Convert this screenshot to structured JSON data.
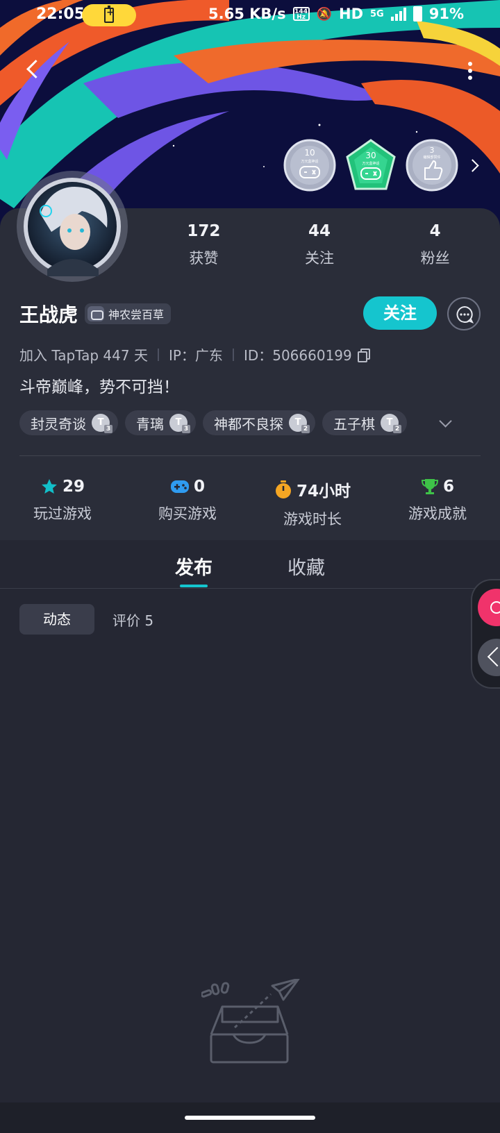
{
  "status_bar": {
    "time": "22:05",
    "net_speed": "5.65 KB/s",
    "hz_label": "144 Hz",
    "hd": "HD",
    "network": "5G",
    "battery": "91%"
  },
  "badges": [
    {
      "icon": "controller-badge-icon",
      "top": "10",
      "sub": "万元盒神话"
    },
    {
      "icon": "controller-badge-active-icon",
      "top": "30",
      "sub": "万元盒神话"
    },
    {
      "icon": "thumbs-up-badge-icon",
      "top": "3",
      "sub": "编辑部赞许"
    }
  ],
  "profile": {
    "name": "王战虎",
    "title_badge": "神农尝百草",
    "stats": [
      {
        "value": "172",
        "label": "获赞"
      },
      {
        "value": "44",
        "label": "关注"
      },
      {
        "value": "4",
        "label": "粉丝"
      }
    ],
    "follow_label": "关注",
    "join_text": "加入 TapTap 447 天",
    "ip_text": "IP：广东",
    "id_text": "ID：506660199",
    "bio": "斗帝巅峰，势不可挡！"
  },
  "tags": [
    {
      "label": "封灵奇谈",
      "level": "3"
    },
    {
      "label": "青璃",
      "level": "3"
    },
    {
      "label": "神都不良探",
      "level": "2"
    },
    {
      "label": "五子棋",
      "level": "2"
    }
  ],
  "game_stats": [
    {
      "value": "29",
      "label": "玩过游戏",
      "icon": "star-icon",
      "color": "#12bfc9"
    },
    {
      "value": "0",
      "label": "购买游戏",
      "icon": "gamepad-icon",
      "color": "#2f9bf0"
    },
    {
      "value": "74小时",
      "label": "游戏时长",
      "icon": "stopwatch-icon",
      "color": "#f5a623"
    },
    {
      "value": "6",
      "label": "游戏成就",
      "icon": "trophy-icon",
      "color": "#3ec248"
    }
  ],
  "tabs": {
    "active": "发布",
    "inactive": "收藏"
  },
  "sub_tabs": {
    "active": "动态",
    "review": "评价 5"
  },
  "colors": {
    "accent": "#15c5ce",
    "background": "#252733",
    "card": "#2a2d39",
    "float_add": "#f0336b"
  }
}
